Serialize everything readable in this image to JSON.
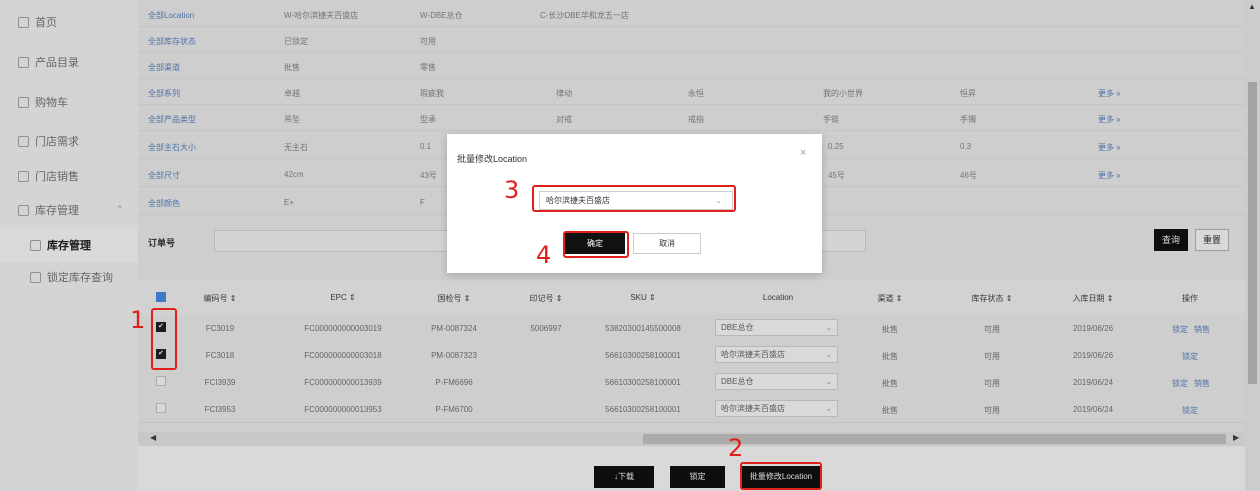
{
  "sidebar": {
    "items": [
      {
        "label": "首页"
      },
      {
        "label": "产品目录"
      },
      {
        "label": "购物车"
      },
      {
        "label": "门店需求"
      },
      {
        "label": "门店销售"
      },
      {
        "label": "库存管理"
      },
      {
        "label": "库存管理"
      },
      {
        "label": "锁定库存查询"
      }
    ]
  },
  "filters": {
    "rows": [
      {
        "label": "全部Location",
        "values": [
          "W-哈尔滨捷夫百盛店",
          "W-DBE总仓",
          "C-长沙DBE华和龙五一店"
        ],
        "more": ""
      },
      {
        "label": "全部库存状态",
        "values": [
          "已锁定",
          "可用"
        ],
        "more": ""
      },
      {
        "label": "全部渠道",
        "values": [
          "批售",
          "零售"
        ],
        "more": ""
      },
      {
        "label": "全部系列",
        "values": [
          "卓越",
          "瑕疵我",
          "律动",
          "永恒",
          "我的小世界",
          "恒昇"
        ],
        "more": "更多 »"
      },
      {
        "label": "全部产品类型",
        "values": [
          "吊坠",
          "型承",
          "对戒",
          "戒指",
          "手链",
          "手镯"
        ],
        "more": "更多 »"
      },
      {
        "label": "全部主石大小",
        "values": [
          "无主石",
          "0.1",
          "",
          "",
          "0.25",
          "0.3"
        ],
        "more": "更多 »"
      },
      {
        "label": "全部尺寸",
        "values": [
          "42cm",
          "43号",
          "",
          "",
          "45号",
          "46号"
        ],
        "more": "更多 »"
      },
      {
        "label": "全部颜色",
        "values": [
          "E+",
          "F"
        ],
        "more": ""
      }
    ],
    "order_label": "订单号",
    "query_button": "查询",
    "reset_button": "重置"
  },
  "table": {
    "headers": [
      "编码号 ⇕",
      "EPC ⇕",
      "国检号 ⇕",
      "印记号 ⇕",
      "SKU ⇕",
      "Location",
      "渠道 ⇕",
      "库存状态 ⇕",
      "入库日期 ⇕",
      "操作"
    ],
    "rows": [
      {
        "checked": true,
        "code": "FC3019",
        "epc": "FC000000000003019",
        "gj": "PM-0087324",
        "yj": "5006997",
        "sku": "5382030014550000​8",
        "location": "DBE总仓",
        "channel": "批售",
        "status": "可用",
        "date": "2019/06/26",
        "actions": [
          "锁定",
          "销售"
        ]
      },
      {
        "checked": true,
        "code": "FC3018",
        "epc": "FC000000000003018",
        "gj": "PM-0087323",
        "yj": "",
        "sku": "56610300258100001",
        "location": "哈尔滨捷夫百盛店",
        "channel": "批售",
        "status": "可用",
        "date": "2019/06/26",
        "actions": [
          "锁定"
        ]
      },
      {
        "checked": false,
        "code": "FCI3939",
        "epc": "FC000000000013939",
        "gj": "P-FM6696",
        "yj": "",
        "sku": "56610300258100001",
        "location": "DBE总仓",
        "channel": "批售",
        "status": "可用",
        "date": "2019/06/24",
        "actions": [
          "锁定",
          "销售"
        ]
      },
      {
        "checked": false,
        "code": "FCI3953",
        "epc": "FC000000000013953",
        "gj": "P-FM6700",
        "yj": "",
        "sku": "56610300258100001",
        "location": "哈尔滨捷夫百盛店",
        "channel": "批售",
        "status": "可用",
        "date": "2019/06/24",
        "actions": [
          "锁定"
        ]
      }
    ]
  },
  "bottom_bar": {
    "download": "↓下载",
    "lock": "锁定",
    "batch_edit": "批量修改Location"
  },
  "modal": {
    "title": "批量修改Location",
    "close": "×",
    "select_value": "哈尔滨捷夫百盛店",
    "ok": "确定",
    "cancel": "取消"
  },
  "annotations": [
    "1",
    "2",
    "3",
    "4"
  ],
  "colors": {
    "accent": "#5b86c9",
    "annotation": "#e0201b",
    "primary_button": "#111111"
  }
}
